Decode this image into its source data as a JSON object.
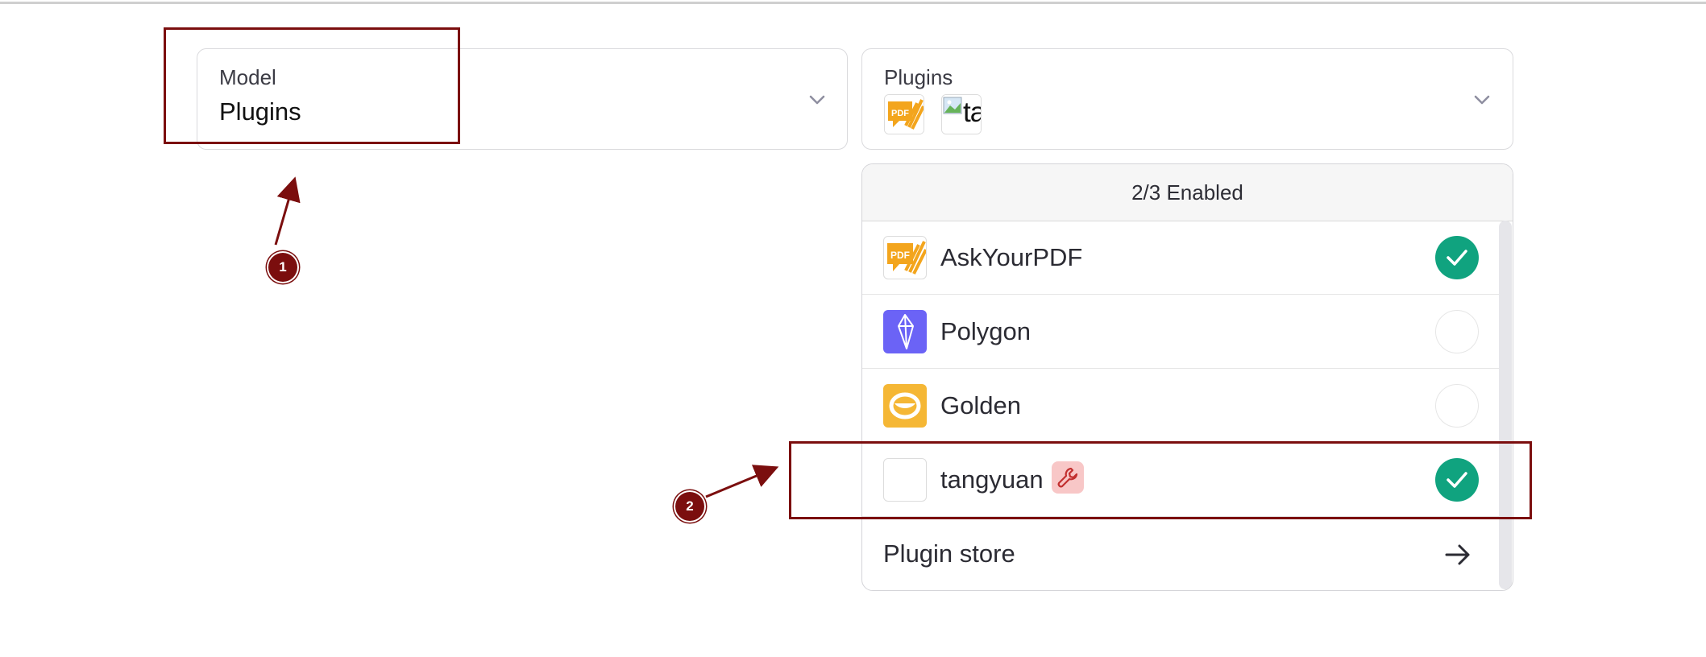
{
  "model_selector": {
    "label": "Model",
    "value": "Plugins",
    "chevron_icon": "chevron-down-icon"
  },
  "plugins_selector": {
    "label": "Plugins",
    "icons": [
      "askyourpdf-logo",
      "broken-image-icon"
    ],
    "broken_image_alt_text": "ta",
    "chevron_icon": "chevron-down-icon"
  },
  "plugin_dropdown": {
    "header": "2/3 Enabled",
    "items": [
      {
        "name": "AskYourPDF",
        "icon": "askyourpdf-logo",
        "enabled": true
      },
      {
        "name": "Polygon",
        "icon": "polygon-logo",
        "enabled": false
      },
      {
        "name": "Golden",
        "icon": "golden-logo",
        "enabled": false
      },
      {
        "name": "tangyuan",
        "icon": "blank-plugin-icon",
        "enabled": true,
        "badge_icon": "wrench-icon"
      }
    ],
    "store_label": "Plugin store",
    "store_icon": "arrow-right-icon"
  },
  "annotations": {
    "badge_1": "1",
    "badge_2": "2"
  },
  "colors": {
    "accent_green": "#10a37f",
    "annotation_red": "#7b0e0e",
    "polygon_purple": "#6b63f6",
    "golden_orange": "#f5b735",
    "pdf_orange": "#f3a51d",
    "dev_badge_pink": "#f8c7c7"
  }
}
